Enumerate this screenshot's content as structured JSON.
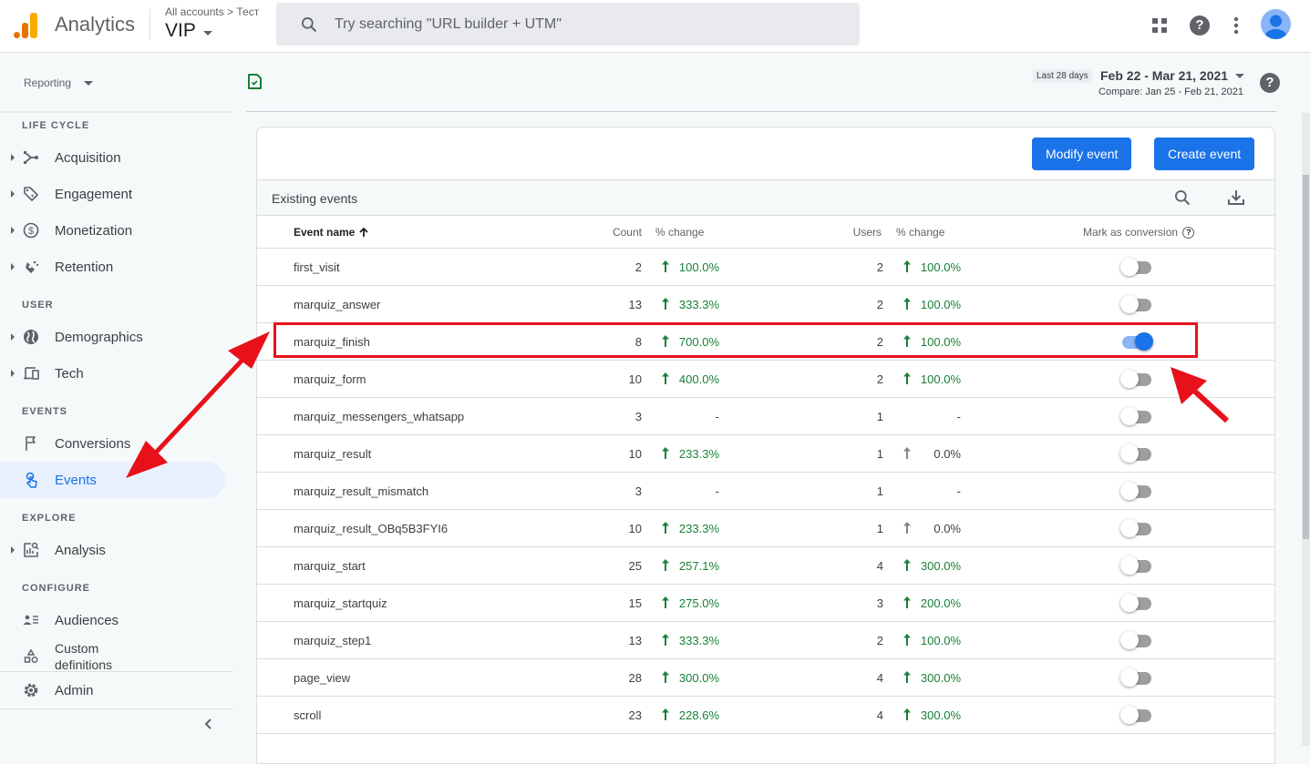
{
  "app": {
    "brand": "Analytics",
    "breadcrumb": "All accounts > Тест",
    "property": "VIP",
    "search_placeholder": "Try searching \"URL builder + UTM\"",
    "colors": {
      "accent": "#1a73e8",
      "positive": "#188038",
      "highlight": "#e8111a",
      "logo_orange": "#f9ab00",
      "logo_dark": "#e37400"
    }
  },
  "topbar_icons": [
    "apps-grid-icon",
    "help-icon",
    "more-vert-icon",
    "account-avatar-icon"
  ],
  "subheader": {
    "reporting_label": "Reporting",
    "date_chip": "Last 28 days",
    "date_range": "Feb 22 - Mar 21, 2021",
    "compare": "Compare: Jan 25 - Feb 21, 2021",
    "help": "?"
  },
  "sidebar": {
    "sections": {
      "lifecycle": "LIFE CYCLE",
      "user": "USER",
      "events": "EVENTS",
      "explore": "EXPLORE",
      "configure": "CONFIGURE"
    },
    "items": {
      "acquisition": "Acquisition",
      "engagement": "Engagement",
      "monetization": "Monetization",
      "retention": "Retention",
      "demographics": "Demographics",
      "tech": "Tech",
      "conversions": "Conversions",
      "events": "Events",
      "analysis": "Analysis",
      "audiences": "Audiences",
      "custom_definitions_1": "Custom",
      "custom_definitions_2": "definitions",
      "admin": "Admin"
    },
    "active": "Events"
  },
  "main": {
    "modify_button": "Modify event",
    "create_button": "Create event",
    "table_title": "Existing events",
    "columns": {
      "name": "Event name",
      "count": "Count",
      "count_change": "% change",
      "users": "Users",
      "users_change": "% change",
      "conversion": "Mark as conversion",
      "conversion_help": "?"
    },
    "sort": "ascending",
    "rows": [
      {
        "name": "first_visit",
        "count": "2",
        "count_change": "100.0%",
        "count_trend": "up-positive",
        "users": "2",
        "users_change": "100.0%",
        "users_trend": "up-positive",
        "conversion": false
      },
      {
        "name": "marquiz_answer",
        "count": "13",
        "count_change": "333.3%",
        "count_trend": "up-positive",
        "users": "2",
        "users_change": "100.0%",
        "users_trend": "up-positive",
        "conversion": false
      },
      {
        "name": "marquiz_finish",
        "count": "8",
        "count_change": "700.0%",
        "count_trend": "up-positive",
        "users": "2",
        "users_change": "100.0%",
        "users_trend": "up-positive",
        "conversion": true
      },
      {
        "name": "marquiz_form",
        "count": "10",
        "count_change": "400.0%",
        "count_trend": "up-positive",
        "users": "2",
        "users_change": "100.0%",
        "users_trend": "up-positive",
        "conversion": false
      },
      {
        "name": "marquiz_messengers_whatsapp",
        "count": "3",
        "count_change": "-",
        "count_trend": "none",
        "users": "1",
        "users_change": "-",
        "users_trend": "none",
        "conversion": false
      },
      {
        "name": "marquiz_result",
        "count": "10",
        "count_change": "233.3%",
        "count_trend": "up-positive",
        "users": "1",
        "users_change": "0.0%",
        "users_trend": "up-neutral",
        "conversion": false
      },
      {
        "name": "marquiz_result_mismatch",
        "count": "3",
        "count_change": "-",
        "count_trend": "none",
        "users": "1",
        "users_change": "-",
        "users_trend": "none",
        "conversion": false
      },
      {
        "name": "marquiz_result_OBq5B3FYI6",
        "count": "10",
        "count_change": "233.3%",
        "count_trend": "up-positive",
        "users": "1",
        "users_change": "0.0%",
        "users_trend": "up-neutral",
        "conversion": false
      },
      {
        "name": "marquiz_start",
        "count": "25",
        "count_change": "257.1%",
        "count_trend": "up-positive",
        "users": "4",
        "users_change": "300.0%",
        "users_trend": "up-positive",
        "conversion": false
      },
      {
        "name": "marquiz_startquiz",
        "count": "15",
        "count_change": "275.0%",
        "count_trend": "up-positive",
        "users": "3",
        "users_change": "200.0%",
        "users_trend": "up-positive",
        "conversion": false
      },
      {
        "name": "marquiz_step1",
        "count": "13",
        "count_change": "333.3%",
        "count_trend": "up-positive",
        "users": "2",
        "users_change": "100.0%",
        "users_trend": "up-positive",
        "conversion": false
      },
      {
        "name": "page_view",
        "count": "28",
        "count_change": "300.0%",
        "count_trend": "up-positive",
        "users": "4",
        "users_change": "300.0%",
        "users_trend": "up-positive",
        "conversion": false
      },
      {
        "name": "scroll",
        "count": "23",
        "count_change": "228.6%",
        "count_trend": "up-positive",
        "users": "4",
        "users_change": "300.0%",
        "users_trend": "up-positive",
        "conversion": false
      }
    ]
  },
  "annotations": {
    "highlighted_row": "marquiz_finish",
    "arrows": [
      "double-arrow-events-to-row",
      "arrow-to-conversion-toggle"
    ]
  }
}
